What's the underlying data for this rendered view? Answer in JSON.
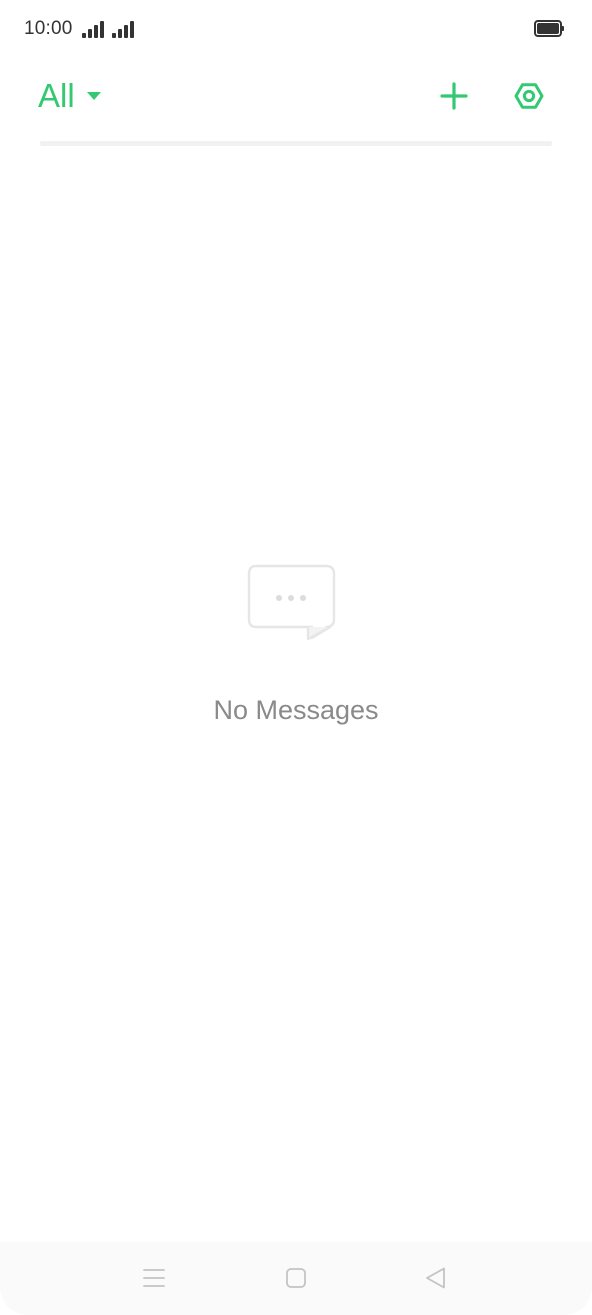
{
  "status_bar": {
    "time": "10:00",
    "icons": [
      "signal-icon",
      "signal-icon",
      "battery-icon"
    ]
  },
  "toolbar": {
    "filter_label": "All",
    "filter_icon": "caret-down-icon",
    "add_icon": "plus-icon",
    "settings_icon": "settings-icon"
  },
  "empty_state": {
    "icon": "message-bubble-icon",
    "text": "No Messages"
  },
  "nav_bar": {
    "icons": [
      "menu-icon",
      "home-icon",
      "back-icon"
    ]
  },
  "colors": {
    "accent": "#33c972",
    "muted_text": "#8a8a8a",
    "status_icons": "#333333"
  }
}
